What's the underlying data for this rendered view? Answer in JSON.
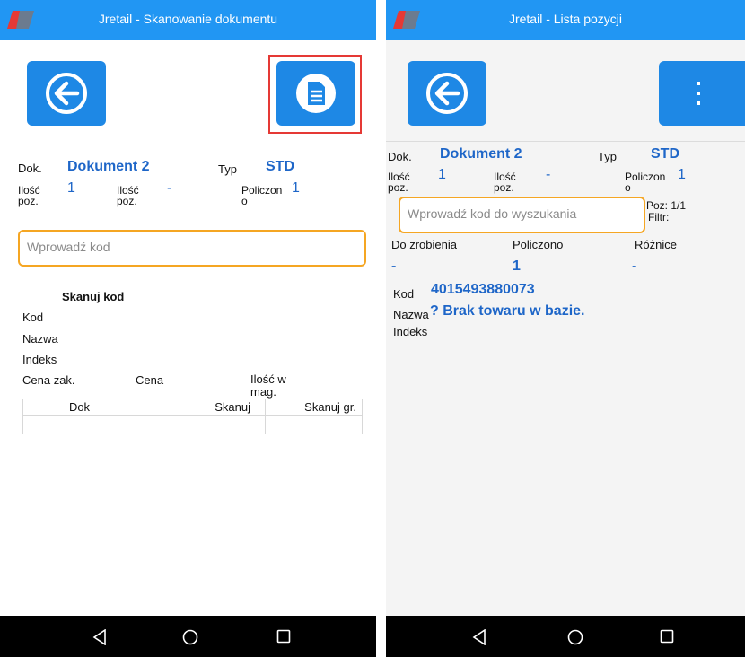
{
  "left": {
    "title": "Jretail - Skanowanie dokumentu",
    "buttons": {
      "back": "back-arrow",
      "document": "document-icon"
    },
    "dok_label": "Dok.",
    "dok_value": "Dokument 2",
    "typ_label": "Typ",
    "typ_value": "STD",
    "ilosc_label_1": "Ilość",
    "ilosc_label_2": "poz.",
    "ilosc_value": "1",
    "ilosc2_label_1": "Ilość",
    "ilosc2_label_2": "poz.",
    "ilosc2_value": "-",
    "policzono_label_1": "Policzon",
    "policzono_label_2": "o",
    "policzono_value": "1",
    "code_placeholder": "Wprowadź kod",
    "scan_header": "Skanuj kod",
    "kod_label": "Kod",
    "nazwa_label": "Nazwa",
    "indeks_label": "Indeks",
    "cena_zak_label": "Cena zak.",
    "cena_label": "Cena",
    "ilosc_mag_label_1": "Ilość w",
    "ilosc_mag_label_2": "mag.",
    "table_headers": [
      "Dok",
      "Skanuj",
      "Skanuj gr."
    ],
    "highlight_color": "#e53935"
  },
  "right": {
    "title": "Jretail - Lista pozycji",
    "dok_label": "Dok.",
    "dok_value": "Dokument 2",
    "typ_label": "Typ",
    "typ_value": "STD",
    "ilosc_label_1": "Ilość",
    "ilosc_label_2": "poz.",
    "ilosc_value": "1",
    "ilosc2_label_1": "Ilość",
    "ilosc2_label_2": "poz.",
    "ilosc2_value": "-",
    "policzono_label_1": "Policzon",
    "policzono_label_2": "o",
    "policzono_value": "1",
    "search_placeholder": "Wprowadź kod do wyszukania",
    "poz_label": "Poz: 1/1",
    "filtr_label": "Filtr:",
    "col_do_zrobienia": "Do zrobienia",
    "col_policzono": "Policzono",
    "col_roznice": "Różnice",
    "val_do_zrobienia": "-",
    "val_policzono": "1",
    "val_roznice": "-",
    "kod_label": "Kod",
    "kod_value": "4015493880073",
    "nazwa_label": "Nazwa",
    "nazwa_value": "? Brak towaru w bazie.",
    "indeks_label": "Indeks"
  },
  "colors": {
    "accent": "#2196f3",
    "button": "#1e88e5",
    "input_border": "#f5a623",
    "value_blue": "#1e66c8"
  }
}
